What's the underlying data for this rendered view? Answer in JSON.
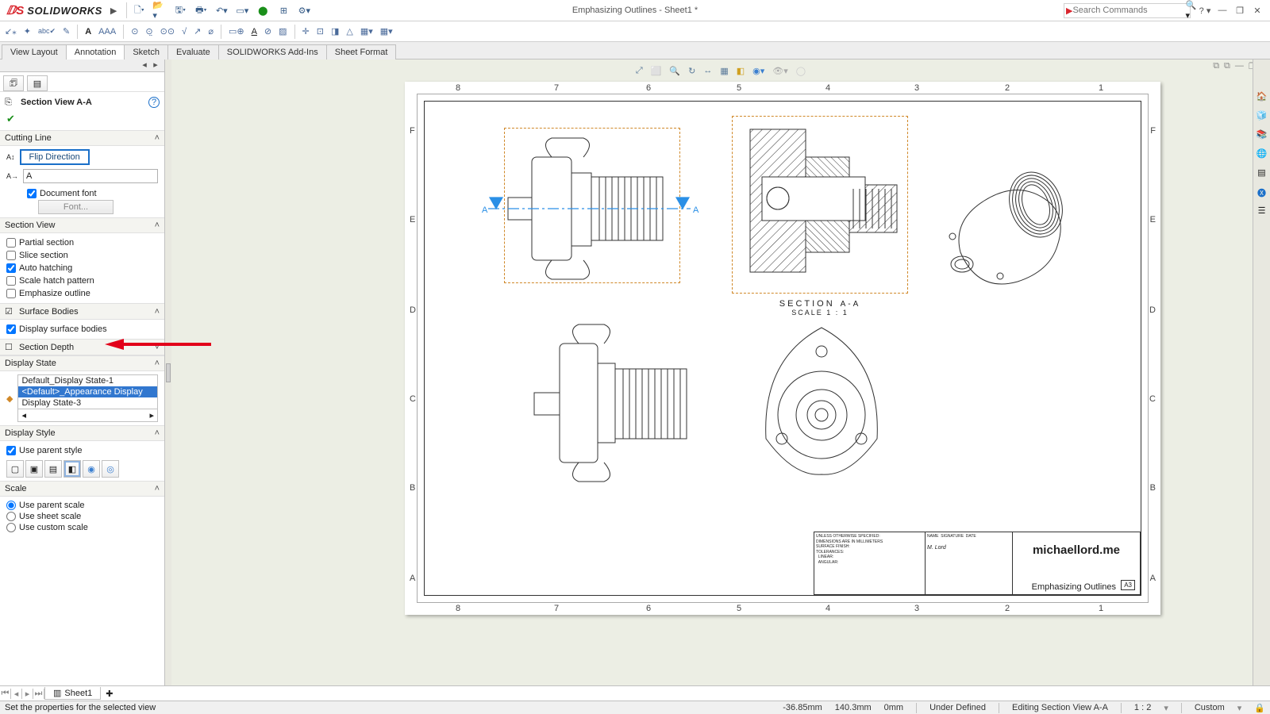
{
  "app": {
    "name": "SOLIDWORKS",
    "doc_title": "Emphasizing Outlines - Sheet1 *"
  },
  "search": {
    "placeholder": "Search Commands"
  },
  "tabs": {
    "items": [
      "View Layout",
      "Annotation",
      "Sketch",
      "Evaluate",
      "SOLIDWORKS Add-Ins",
      "Sheet Format"
    ],
    "active": 1
  },
  "pm": {
    "title": "Section View A-A",
    "cutting_line": {
      "header": "Cutting Line",
      "flip": "Flip Direction",
      "name": "A",
      "doc_font": "Document font",
      "font_btn": "Font..."
    },
    "section_view": {
      "header": "Section View",
      "partial": "Partial section",
      "slice": "Slice section",
      "auto_hatch": "Auto hatching",
      "scale_hatch": "Scale hatch pattern",
      "emph": "Emphasize outline"
    },
    "surf": {
      "header": "Surface Bodies",
      "disp": "Display surface bodies"
    },
    "depth": {
      "header": "Section Depth"
    },
    "disp_state": {
      "header": "Display State",
      "items": [
        "Default_Display State-1",
        "<Default>_Appearance Display",
        "Display State-3"
      ],
      "selected": 1
    },
    "disp_style": {
      "header": "Display Style",
      "parent": "Use parent style"
    },
    "scale": {
      "header": "Scale",
      "parent": "Use parent scale",
      "sheet": "Use sheet scale",
      "custom": "Use custom scale"
    }
  },
  "canvas": {
    "cols": [
      "8",
      "7",
      "6",
      "5",
      "4",
      "3",
      "2",
      "1"
    ],
    "rows": [
      "F",
      "E",
      "D",
      "C",
      "B",
      "A"
    ],
    "section_label": "SECTION",
    "section_suffix": "A-A",
    "scale_label": "SCALE 1 : 1",
    "arrow_left": "A",
    "arrow_right": "A"
  },
  "titleblock": {
    "brand": "michaellord.me",
    "name": "Emphasizing Outlines",
    "size": "A3",
    "signed": "M. Lord"
  },
  "sheet_tabs": {
    "active": "Sheet1"
  },
  "status": {
    "msg": "Set the properties for the selected view",
    "x": "-36.85mm",
    "y": "140.3mm",
    "z": "0mm",
    "constraint": "Under Defined",
    "edit": "Editing Section View A-A",
    "zoom": "1 : 2",
    "units": "Custom"
  }
}
